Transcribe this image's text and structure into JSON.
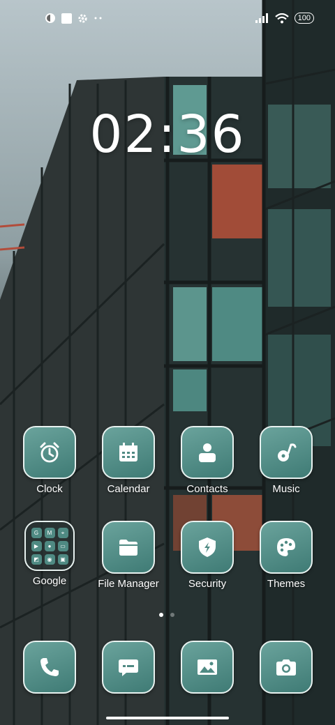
{
  "status_bar": {
    "battery": "100",
    "left_icons": [
      "app-badge-icon",
      "square-icon",
      "gear-icon",
      "more-dots-icon"
    ],
    "right_icons": [
      "signal-icon",
      "wifi-icon",
      "battery-icon"
    ]
  },
  "clock": {
    "time": "02:36"
  },
  "home_apps": [
    {
      "label": "Clock",
      "icon": "alarm-clock-icon"
    },
    {
      "label": "Calendar",
      "icon": "calendar-icon"
    },
    {
      "label": "Contacts",
      "icon": "contacts-icon"
    },
    {
      "label": "Music",
      "icon": "music-icon"
    },
    {
      "label": "Google",
      "icon": "folder-icon"
    },
    {
      "label": "File Manager",
      "icon": "folder-icon"
    },
    {
      "label": "Security",
      "icon": "shield-icon"
    },
    {
      "label": "Themes",
      "icon": "palette-icon"
    }
  ],
  "google_folder": {
    "mini_icons": [
      "G",
      "M",
      "⌖",
      "▶",
      "●",
      "▭",
      "◩",
      "◉",
      "▣"
    ]
  },
  "dock": [
    {
      "icon": "phone-icon"
    },
    {
      "icon": "messages-icon"
    },
    {
      "icon": "gallery-icon"
    },
    {
      "icon": "camera-icon"
    }
  ],
  "page_indicator": {
    "pages": 2,
    "current": 1
  },
  "colors": {
    "tile": "#4f8a83",
    "tile_border": "#e8f2f0",
    "text": "#ffffff"
  }
}
